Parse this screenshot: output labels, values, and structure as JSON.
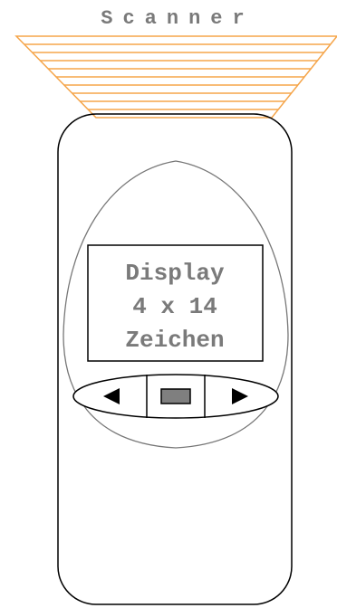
{
  "scanner": {
    "label": "Scanner",
    "beam_color": "#f5a54a"
  },
  "device": {
    "outline_color": "#000000",
    "inner_curve_color": "#777777"
  },
  "display": {
    "lines": [
      "Display",
      "4 x 14",
      "Zeichen"
    ],
    "text_color": "#7a7a7a"
  },
  "keypad": {
    "left_key_icon": "triangle-left-icon",
    "center_key_icon": "rectangle-icon",
    "right_key_icon": "triangle-right-icon",
    "center_key_fill": "#7f7f7f"
  }
}
